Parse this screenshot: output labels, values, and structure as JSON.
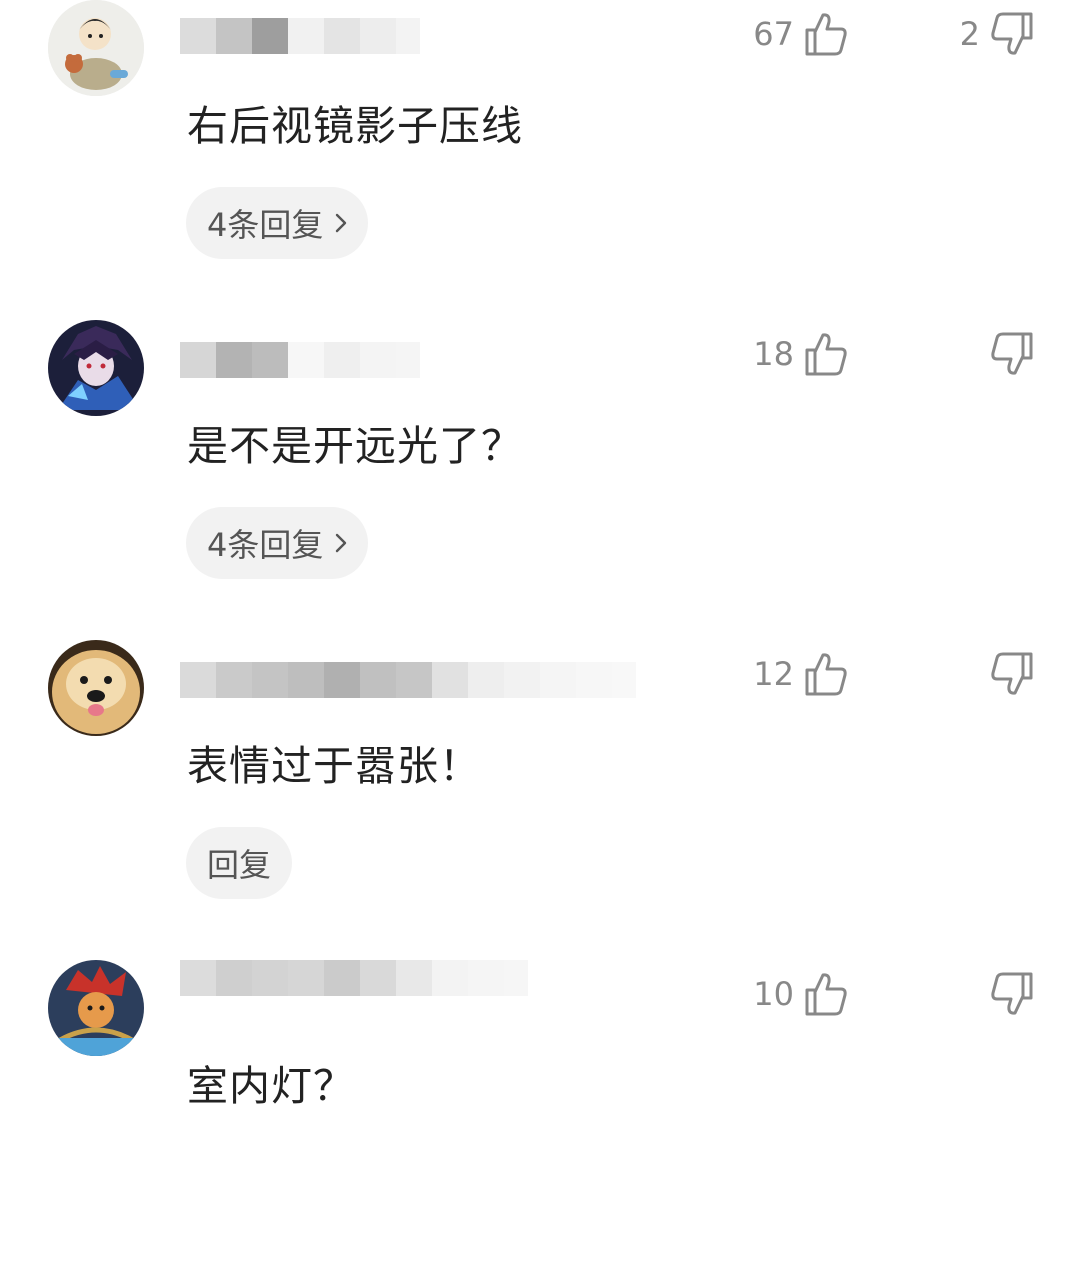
{
  "comments": [
    {
      "text": "右后视镜影子压线",
      "likes": "67",
      "dislikes": "2",
      "reply_label": "4条回复"
    },
    {
      "text": "是不是开远光了？",
      "likes": "18",
      "dislikes": "",
      "reply_label": "4条回复"
    },
    {
      "text": "表情过于嚣张！",
      "likes": "12",
      "dislikes": "",
      "reply_label": "回复"
    },
    {
      "text": "室内灯？",
      "likes": "10",
      "dislikes": ""
    }
  ],
  "icons": {
    "like": "thumbs-up-outline",
    "dislike": "thumbs-down-outline",
    "chevron": "chevron-right"
  },
  "colors": {
    "text": "#222222",
    "count": "#888888",
    "pill_bg": "#f2f2f2",
    "pill_text": "#555555"
  }
}
